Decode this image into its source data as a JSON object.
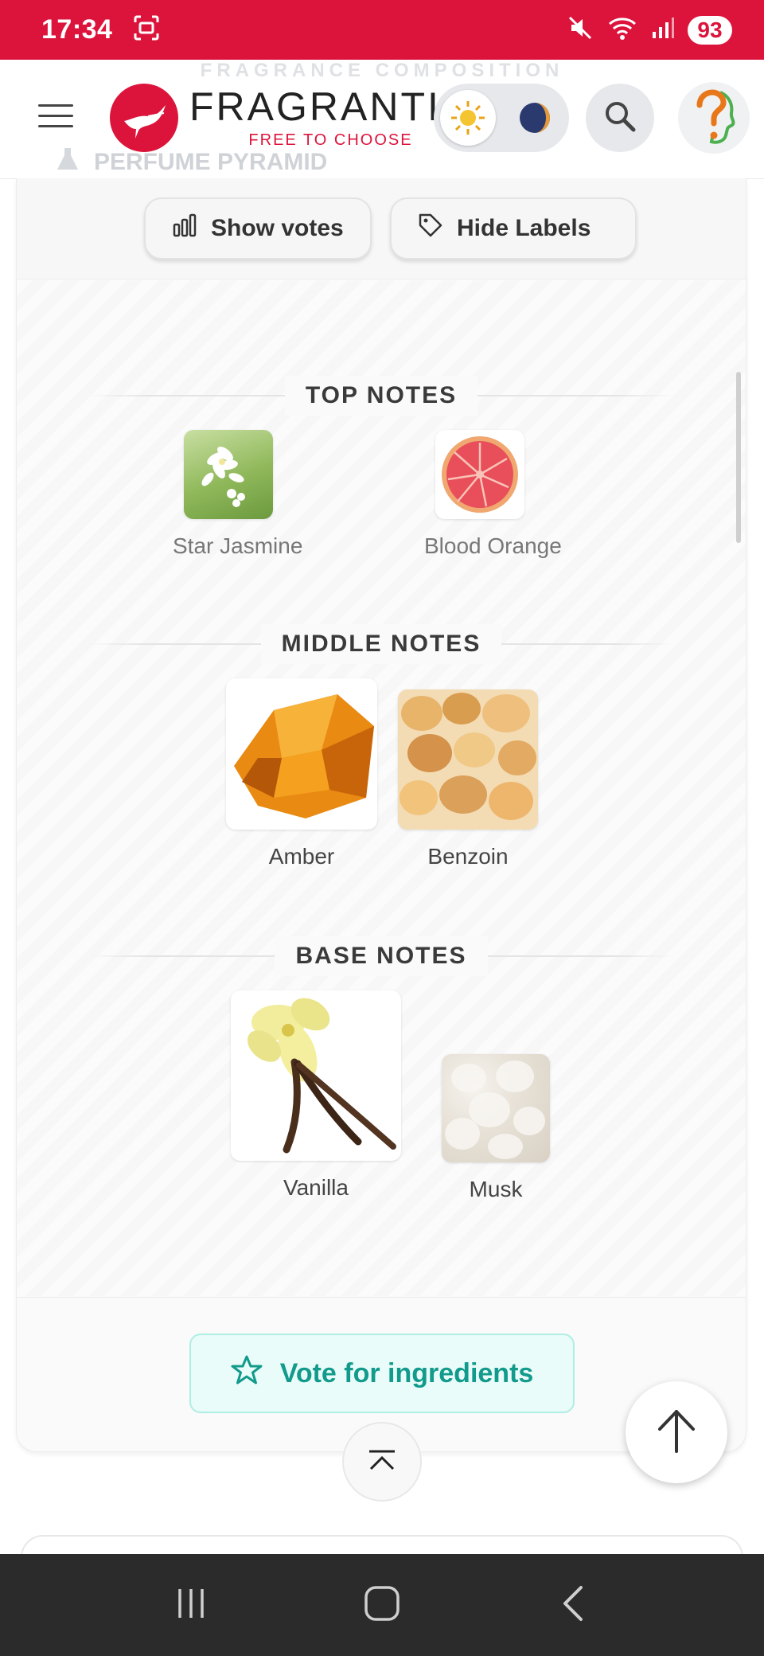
{
  "status_bar": {
    "time": "17:34",
    "battery": "93",
    "icons": [
      "screenshot-icon",
      "mute-icon",
      "wifi-icon",
      "signal-icon"
    ]
  },
  "header": {
    "ghost_composition_text": "FRAGRANCE COMPOSITION",
    "ghost_pyramid_text": "PERFUME PYRAMID",
    "logo_name": "FRAGRANTIC",
    "logo_tagline": "FREE TO CHOOSE",
    "brand_color": "#dc143c"
  },
  "controls": {
    "show_votes": "Show votes",
    "hide_labels": "Hide Labels"
  },
  "pyramid": {
    "top": {
      "heading": "TOP NOTES",
      "notes": [
        {
          "name": "Star Jasmine",
          "image": "jasmine-flower"
        },
        {
          "name": "Blood Orange",
          "image": "blood-orange-slice"
        }
      ]
    },
    "middle": {
      "heading": "MIDDLE NOTES",
      "notes": [
        {
          "name": "Amber",
          "image": "amber-resin"
        },
        {
          "name": "Benzoin",
          "image": "benzoin-resin"
        }
      ]
    },
    "base": {
      "heading": "BASE NOTES",
      "notes": [
        {
          "name": "Vanilla",
          "image": "vanilla-flower-pods"
        },
        {
          "name": "Musk",
          "image": "musk-texture"
        }
      ]
    }
  },
  "footer": {
    "vote_button": "Vote for ingredients",
    "accent_color": "#129b8c"
  }
}
